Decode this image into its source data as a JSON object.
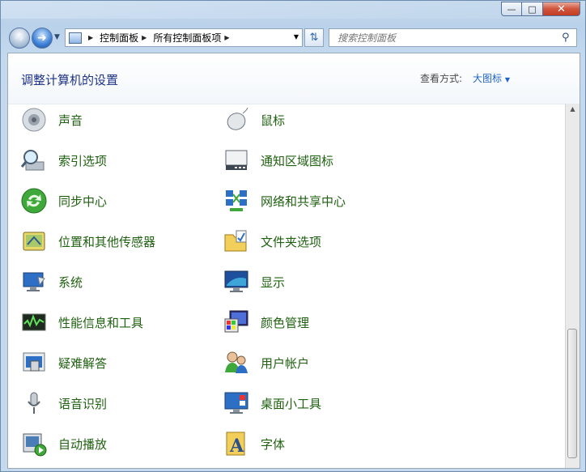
{
  "nav": {
    "breadcrumbs": [
      "控制面板",
      "所有控制面板项"
    ],
    "search_placeholder": "搜索控制面板"
  },
  "header": {
    "title": "调整计算机的设置",
    "view_by_label": "查看方式:",
    "view_by_value": "大图标"
  },
  "items_left": [
    {
      "label": "声音",
      "icon": "speaker-icon"
    },
    {
      "label": "索引选项",
      "icon": "index-search-icon"
    },
    {
      "label": "同步中心",
      "icon": "sync-icon"
    },
    {
      "label": "位置和其他传感器",
      "icon": "location-sensor-icon"
    },
    {
      "label": "系统",
      "icon": "system-monitor-icon"
    },
    {
      "label": "性能信息和工具",
      "icon": "performance-icon"
    },
    {
      "label": "疑难解答",
      "icon": "troubleshoot-icon"
    },
    {
      "label": "语音识别",
      "icon": "microphone-icon"
    },
    {
      "label": "自动播放",
      "icon": "autoplay-icon"
    }
  ],
  "items_right": [
    {
      "label": "鼠标",
      "icon": "mouse-icon"
    },
    {
      "label": "通知区域图标",
      "icon": "notification-area-icon"
    },
    {
      "label": "网络和共享中心",
      "icon": "network-icon"
    },
    {
      "label": "文件夹选项",
      "icon": "folder-options-icon"
    },
    {
      "label": "显示",
      "icon": "display-icon"
    },
    {
      "label": "颜色管理",
      "icon": "color-management-icon"
    },
    {
      "label": "用户帐户",
      "icon": "user-accounts-icon"
    },
    {
      "label": "桌面小工具",
      "icon": "desktop-gadgets-icon"
    },
    {
      "label": "字体",
      "icon": "fonts-icon"
    }
  ],
  "colors": {
    "title": "#1e3287",
    "item_label": "#1f6110",
    "link": "#1e64c8"
  }
}
